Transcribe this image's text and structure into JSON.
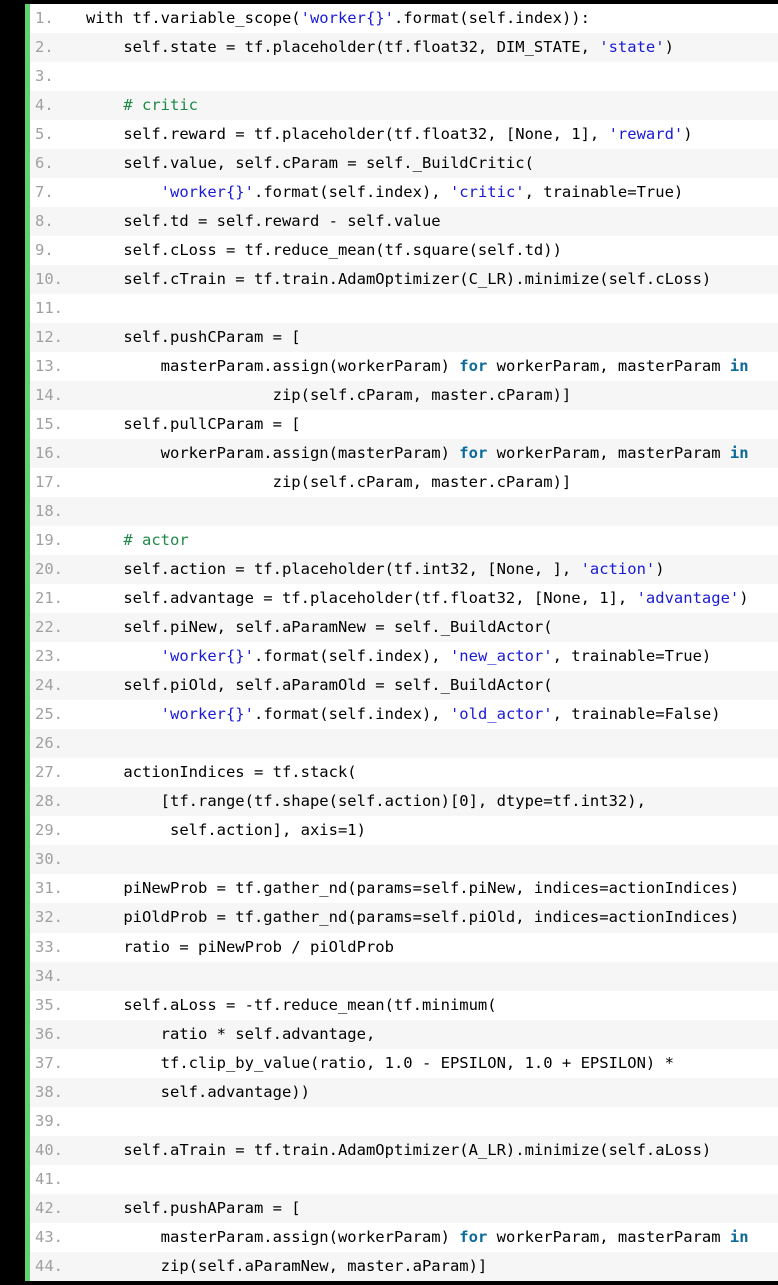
{
  "viewer": {
    "title": "Python source code snippet",
    "language": "python",
    "line_count": 44,
    "first_line_number": 1,
    "colors": {
      "background": "#000000",
      "accent_bar": "#62d26f",
      "surface": "#ffffff",
      "alt_row": "#f6f6f6",
      "line_number": "#a0a0a0",
      "text": "#000000",
      "string": "#1a1ad6",
      "comment": "#1d8a47",
      "keyword": "#0b6a99"
    }
  },
  "lines": [
    {
      "n": "1.",
      "tokens": [
        {
          "t": "plain",
          "s": "with tf.variable_scope("
        },
        {
          "t": "string",
          "s": "'worker{}'"
        },
        {
          "t": "plain",
          "s": ".format(self.index)):"
        }
      ]
    },
    {
      "n": "2.",
      "tokens": [
        {
          "t": "plain",
          "s": "    self.state = tf.placeholder(tf.float32, DIM_STATE, "
        },
        {
          "t": "string",
          "s": "'state'"
        },
        {
          "t": "plain",
          "s": ")"
        }
      ]
    },
    {
      "n": "3.",
      "tokens": [
        {
          "t": "plain",
          "s": ""
        }
      ]
    },
    {
      "n": "4.",
      "tokens": [
        {
          "t": "plain",
          "s": "    "
        },
        {
          "t": "comment",
          "s": "# critic"
        }
      ]
    },
    {
      "n": "5.",
      "tokens": [
        {
          "t": "plain",
          "s": "    self.reward = tf.placeholder(tf.float32, [None, 1], "
        },
        {
          "t": "string",
          "s": "'reward'"
        },
        {
          "t": "plain",
          "s": ")"
        }
      ]
    },
    {
      "n": "6.",
      "tokens": [
        {
          "t": "plain",
          "s": "    self.value, self.cParam = self._BuildCritic("
        }
      ]
    },
    {
      "n": "7.",
      "tokens": [
        {
          "t": "plain",
          "s": "        "
        },
        {
          "t": "string",
          "s": "'worker{}'"
        },
        {
          "t": "plain",
          "s": ".format(self.index), "
        },
        {
          "t": "string",
          "s": "'critic'"
        },
        {
          "t": "plain",
          "s": ", trainable=True)"
        }
      ]
    },
    {
      "n": "8.",
      "tokens": [
        {
          "t": "plain",
          "s": "    self.td = self.reward - self.value"
        }
      ]
    },
    {
      "n": "9.",
      "tokens": [
        {
          "t": "plain",
          "s": "    self.cLoss = tf.reduce_mean(tf.square(self.td))"
        }
      ]
    },
    {
      "n": "10.",
      "tokens": [
        {
          "t": "plain",
          "s": "    self.cTrain = tf.train.AdamOptimizer(C_LR).minimize(self.cLoss)"
        }
      ]
    },
    {
      "n": "11.",
      "tokens": [
        {
          "t": "plain",
          "s": ""
        }
      ]
    },
    {
      "n": "12.",
      "tokens": [
        {
          "t": "plain",
          "s": "    self.pushCParam = ["
        }
      ]
    },
    {
      "n": "13.",
      "tokens": [
        {
          "t": "plain",
          "s": "        masterParam.assign(workerParam) "
        },
        {
          "t": "keyword",
          "s": "for"
        },
        {
          "t": "plain",
          "s": " workerParam, masterParam "
        },
        {
          "t": "keyword",
          "s": "in"
        }
      ]
    },
    {
      "n": "14.",
      "tokens": [
        {
          "t": "plain",
          "s": "                    zip(self.cParam, master.cParam)]"
        }
      ]
    },
    {
      "n": "15.",
      "tokens": [
        {
          "t": "plain",
          "s": "    self.pullCParam = ["
        }
      ]
    },
    {
      "n": "16.",
      "tokens": [
        {
          "t": "plain",
          "s": "        workerParam.assign(masterParam) "
        },
        {
          "t": "keyword",
          "s": "for"
        },
        {
          "t": "plain",
          "s": " workerParam, masterParam "
        },
        {
          "t": "keyword",
          "s": "in"
        }
      ]
    },
    {
      "n": "17.",
      "tokens": [
        {
          "t": "plain",
          "s": "                    zip(self.cParam, master.cParam)]"
        }
      ]
    },
    {
      "n": "18.",
      "tokens": [
        {
          "t": "plain",
          "s": ""
        }
      ]
    },
    {
      "n": "19.",
      "tokens": [
        {
          "t": "plain",
          "s": "    "
        },
        {
          "t": "comment",
          "s": "# actor"
        }
      ]
    },
    {
      "n": "20.",
      "tokens": [
        {
          "t": "plain",
          "s": "    self.action = tf.placeholder(tf.int32, [None, ], "
        },
        {
          "t": "string",
          "s": "'action'"
        },
        {
          "t": "plain",
          "s": ")"
        }
      ]
    },
    {
      "n": "21.",
      "tokens": [
        {
          "t": "plain",
          "s": "    self.advantage = tf.placeholder(tf.float32, [None, 1], "
        },
        {
          "t": "string",
          "s": "'advantage'"
        },
        {
          "t": "plain",
          "s": ")"
        }
      ]
    },
    {
      "n": "22.",
      "tokens": [
        {
          "t": "plain",
          "s": "    self.piNew, self.aParamNew = self._BuildActor("
        }
      ]
    },
    {
      "n": "23.",
      "tokens": [
        {
          "t": "plain",
          "s": "        "
        },
        {
          "t": "string",
          "s": "'worker{}'"
        },
        {
          "t": "plain",
          "s": ".format(self.index), "
        },
        {
          "t": "string",
          "s": "'new_actor'"
        },
        {
          "t": "plain",
          "s": ", trainable=True)"
        }
      ]
    },
    {
      "n": "24.",
      "tokens": [
        {
          "t": "plain",
          "s": "    self.piOld, self.aParamOld = self._BuildActor("
        }
      ]
    },
    {
      "n": "25.",
      "tokens": [
        {
          "t": "plain",
          "s": "        "
        },
        {
          "t": "string",
          "s": "'worker{}'"
        },
        {
          "t": "plain",
          "s": ".format(self.index), "
        },
        {
          "t": "string",
          "s": "'old_actor'"
        },
        {
          "t": "plain",
          "s": ", trainable=False)"
        }
      ]
    },
    {
      "n": "26.",
      "tokens": [
        {
          "t": "plain",
          "s": ""
        }
      ]
    },
    {
      "n": "27.",
      "tokens": [
        {
          "t": "plain",
          "s": "    actionIndices = tf.stack("
        }
      ]
    },
    {
      "n": "28.",
      "tokens": [
        {
          "t": "plain",
          "s": "        [tf.range(tf.shape(self.action)[0], dtype=tf.int32),"
        }
      ]
    },
    {
      "n": "29.",
      "tokens": [
        {
          "t": "plain",
          "s": "         self.action], axis=1)"
        }
      ]
    },
    {
      "n": "30.",
      "tokens": [
        {
          "t": "plain",
          "s": ""
        }
      ]
    },
    {
      "n": "31.",
      "tokens": [
        {
          "t": "plain",
          "s": "    piNewProb = tf.gather_nd(params=self.piNew, indices=actionIndices)"
        }
      ]
    },
    {
      "n": "32.",
      "tokens": [
        {
          "t": "plain",
          "s": "    piOldProb = tf.gather_nd(params=self.piOld, indices=actionIndices)"
        }
      ]
    },
    {
      "n": "33.",
      "tokens": [
        {
          "t": "plain",
          "s": "    ratio = piNewProb / piOldProb"
        }
      ]
    },
    {
      "n": "34.",
      "tokens": [
        {
          "t": "plain",
          "s": ""
        }
      ]
    },
    {
      "n": "35.",
      "tokens": [
        {
          "t": "plain",
          "s": "    self.aLoss = -tf.reduce_mean(tf.minimum("
        }
      ]
    },
    {
      "n": "36.",
      "tokens": [
        {
          "t": "plain",
          "s": "        ratio * self.advantage,"
        }
      ]
    },
    {
      "n": "37.",
      "tokens": [
        {
          "t": "plain",
          "s": "        tf.clip_by_value(ratio, 1.0 - EPSILON, 1.0 + EPSILON) *"
        }
      ]
    },
    {
      "n": "38.",
      "tokens": [
        {
          "t": "plain",
          "s": "        self.advantage))"
        }
      ]
    },
    {
      "n": "39.",
      "tokens": [
        {
          "t": "plain",
          "s": ""
        }
      ]
    },
    {
      "n": "40.",
      "tokens": [
        {
          "t": "plain",
          "s": "    self.aTrain = tf.train.AdamOptimizer(A_LR).minimize(self.aLoss)"
        }
      ]
    },
    {
      "n": "41.",
      "tokens": [
        {
          "t": "plain",
          "s": ""
        }
      ]
    },
    {
      "n": "42.",
      "tokens": [
        {
          "t": "plain",
          "s": "    self.pushAParam = ["
        }
      ]
    },
    {
      "n": "43.",
      "tokens": [
        {
          "t": "plain",
          "s": "        masterParam.assign(workerParam) "
        },
        {
          "t": "keyword",
          "s": "for"
        },
        {
          "t": "plain",
          "s": " workerParam, masterParam "
        },
        {
          "t": "keyword",
          "s": "in"
        }
      ]
    },
    {
      "n": "44.",
      "tokens": [
        {
          "t": "plain",
          "s": "        zip(self.aParamNew, master.aParam)]"
        }
      ]
    }
  ]
}
